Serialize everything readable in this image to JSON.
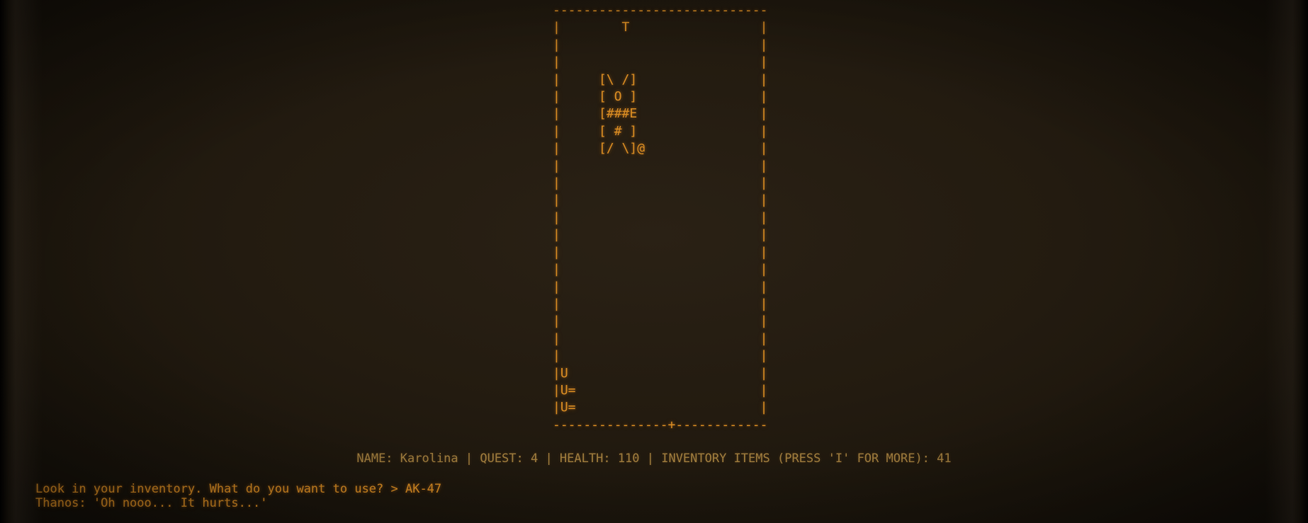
{
  "board": {
    "lines": [
      "----------------------------",
      "|        T                 |",
      "|                          |",
      "|                          |",
      "|     [\\ /]                |",
      "|     [ O ]                |",
      "|     [###E                |",
      "|     [ # ]                |",
      "|     [/ \\]@               |",
      "|                          |",
      "|                          |",
      "|                          |",
      "|                          |",
      "|                          |",
      "|                          |",
      "|                          |",
      "|                          |",
      "|                          |",
      "|                          |",
      "|                          |",
      "|                          |",
      "|U                         |",
      "|U=                        |",
      "|U=                        |",
      "---------------+------------"
    ]
  },
  "status_bar": "NAME: Karolina | QUEST: 4 | HEALTH: 110 | INVENTORY ITEMS (PRESS 'I' FOR MORE): 41",
  "console": [
    "Look in your inventory. What do you want to use? > AK-47",
    "Thanos: 'Oh nooo... It hurts...'"
  ],
  "colors": {
    "text": "#d58a22",
    "status_text": "#9c7a3c",
    "background": "#221a10"
  }
}
